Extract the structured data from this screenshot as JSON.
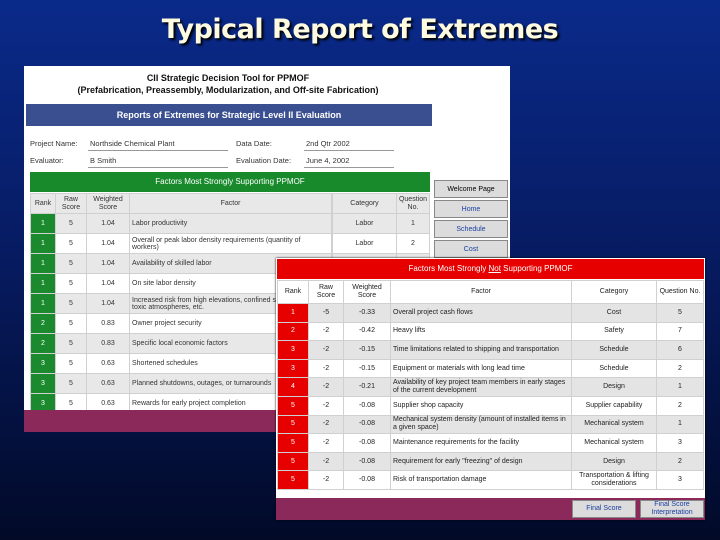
{
  "slide_title": "Typical Report of Extremes",
  "tool_header": {
    "line1": "CII Strategic Decision Tool for PPMOF",
    "line2": "(Prefabrication, Preassembly, Modularization, and Off-site Fabrication)"
  },
  "report_title": "Reports of Extremes for Strategic Level II Evaluation",
  "info": {
    "project_name_label": "Project Name:",
    "project_name_value": "Northside Chemical Plant",
    "evaluator_label": "Evaluator:",
    "evaluator_value": "B Smith",
    "data_date_label": "Data Date:",
    "data_date_value": "2nd Qtr 2002",
    "evaluation_date_label": "Evaluation Date:",
    "evaluation_date_value": "June 4, 2002"
  },
  "supporting": {
    "title": "Factors Most Strongly Supporting PPMOF",
    "headers": {
      "rank": "Rank",
      "raw": "Raw Score",
      "weighted": "Weighted Score",
      "factor": "Factor",
      "category": "Category",
      "question": "Question No."
    },
    "rows": [
      {
        "rank": "1",
        "raw": "5",
        "weighted": "1.04",
        "factor": "Labor productivity",
        "category": "Labor",
        "question": "1"
      },
      {
        "rank": "1",
        "raw": "5",
        "weighted": "1.04",
        "factor": "Overall or peak labor density requirements (quantity of workers)",
        "category": "Labor",
        "question": "2"
      },
      {
        "rank": "1",
        "raw": "5",
        "weighted": "1.04",
        "factor": "Availability of skilled labor",
        "category": "",
        "question": ""
      },
      {
        "rank": "1",
        "raw": "5",
        "weighted": "1.04",
        "factor": "On site labor density",
        "category": "",
        "question": ""
      },
      {
        "rank": "1",
        "raw": "5",
        "weighted": "1.04",
        "factor": "Increased risk from high elevations, confined spaces, known toxic atmospheres, etc.",
        "category": "",
        "question": ""
      },
      {
        "rank": "2",
        "raw": "5",
        "weighted": "0.83",
        "factor": "Owner project security",
        "category": "",
        "question": ""
      },
      {
        "rank": "2",
        "raw": "5",
        "weighted": "0.83",
        "factor": "Specific local economic factors",
        "category": "",
        "question": ""
      },
      {
        "rank": "3",
        "raw": "5",
        "weighted": "0.63",
        "factor": "Shortened schedules",
        "category": "",
        "question": ""
      },
      {
        "rank": "3",
        "raw": "5",
        "weighted": "0.63",
        "factor": "Planned shutdowns, outages, or turnarounds",
        "category": "",
        "question": ""
      },
      {
        "rank": "3",
        "raw": "5",
        "weighted": "0.63",
        "factor": "Rewards for early project completion",
        "category": "",
        "question": ""
      }
    ]
  },
  "nav": {
    "welcome": "Welcome Page",
    "home": "Home",
    "schedule": "Schedule",
    "cost": "Cost"
  },
  "not_supporting": {
    "title_pre": "Factors Most Strongly ",
    "title_not": "Not",
    "title_post": " Supporting PPMOF",
    "headers": {
      "rank": "Rank",
      "raw": "Raw Score",
      "weighted": "Weighted Score",
      "factor": "Factor",
      "category": "Category",
      "question": "Question No."
    },
    "rows": [
      {
        "rank": "1",
        "raw": "-5",
        "weighted": "-0.33",
        "factor": "Overall project cash flows",
        "category": "Cost",
        "question": "5"
      },
      {
        "rank": "2",
        "raw": "-2",
        "weighted": "-0.42",
        "factor": "Heavy lifts",
        "category": "Safety",
        "question": "7"
      },
      {
        "rank": "3",
        "raw": "-2",
        "weighted": "-0.15",
        "factor": "Time limitations related to shipping and transportation",
        "category": "Schedule",
        "question": "6"
      },
      {
        "rank": "3",
        "raw": "-2",
        "weighted": "-0.15",
        "factor": "Equipment or materials with long lead time",
        "category": "Schedule",
        "question": "2"
      },
      {
        "rank": "4",
        "raw": "-2",
        "weighted": "-0.21",
        "factor": "Availability of key project team members in early stages of the current development",
        "category": "Design",
        "question": "1"
      },
      {
        "rank": "5",
        "raw": "-2",
        "weighted": "-0.08",
        "factor": "Supplier shop capacity",
        "category": "Supplier capability",
        "question": "2"
      },
      {
        "rank": "5",
        "raw": "-2",
        "weighted": "-0.08",
        "factor": "Mechanical system density (amount of installed items in a given space)",
        "category": "Mechanical system",
        "question": "1"
      },
      {
        "rank": "5",
        "raw": "-2",
        "weighted": "-0.08",
        "factor": "Maintenance requirements for the facility",
        "category": "Mechanical system",
        "question": "3"
      },
      {
        "rank": "5",
        "raw": "-2",
        "weighted": "-0.08",
        "factor": "Requirement for early \"freezing\" of design",
        "category": "Design",
        "question": "2"
      },
      {
        "rank": "5",
        "raw": "-2",
        "weighted": "-0.08",
        "factor": "Risk of transportation damage",
        "category": "Transportation & lifting considerations",
        "question": "3"
      }
    ]
  },
  "buttons": {
    "final_score": "Final Score",
    "final_score_interp": "Final Score Interpretation"
  }
}
